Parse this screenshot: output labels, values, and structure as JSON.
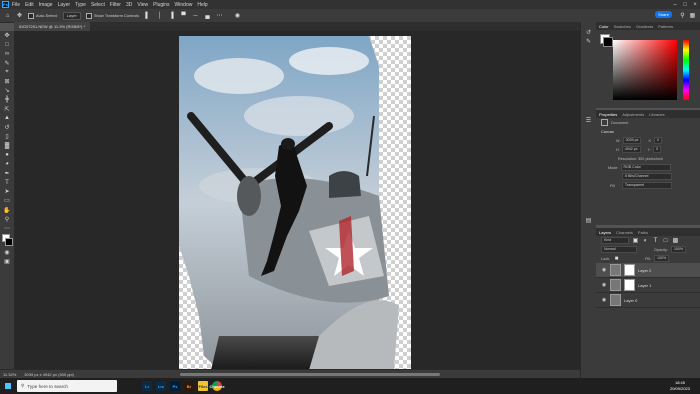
{
  "app": {
    "logo": "Ps",
    "menus": [
      "File",
      "Edit",
      "Image",
      "Layer",
      "Type",
      "Select",
      "Filter",
      "3D",
      "View",
      "Plugins",
      "Window",
      "Help"
    ],
    "window_controls": [
      "minimize-icon",
      "maximize-icon",
      "close-icon"
    ]
  },
  "options_bar": {
    "auto_select_label": "Auto-Select:",
    "auto_select_value": "Layer",
    "transform_label": "Show Transform Controls",
    "share_label": "Share"
  },
  "document": {
    "tab_title": "IDG07251.NEW @ 11.3% (RGB/8*) *"
  },
  "status": {
    "zoom": "11.32%",
    "doc_size": "3039 px x 4942 px (300 ppi)"
  },
  "color_panel": {
    "tabs": [
      "Color",
      "Swatches",
      "Gradients",
      "Patterns"
    ],
    "accent": "#ff0000"
  },
  "properties_panel": {
    "tabs": [
      "Properties",
      "Adjustments",
      "Libraries"
    ],
    "doc_label": "Document",
    "canvas_heading": "Canvas",
    "w_label": "W",
    "w_value": "3039 px",
    "h_label": "H",
    "h_value": "4942 px",
    "x_label": "X",
    "x_value": "0",
    "y_label": "Y",
    "y_value": "0",
    "resolution": "Resolution: 300 pixels/inch",
    "mode_label": "Mode",
    "mode_value": "RGB Color",
    "depth_value": "8 Bits/Channel",
    "fill_label": "Fill",
    "fill_value": "Transparent"
  },
  "layers_panel": {
    "tabs": [
      "Layers",
      "Channels",
      "Paths"
    ],
    "kind_label": "Kind",
    "blend_mode": "Normal",
    "opacity_label": "Opacity:",
    "opacity_value": "100%",
    "lock_label": "Lock:",
    "fill_label": "Fill:",
    "fill_value": "100%",
    "layers": [
      {
        "name": "Layer 2",
        "visible": true,
        "selected": true
      },
      {
        "name": "Layer 1",
        "visible": true,
        "selected": false
      },
      {
        "name": "Layer 0",
        "visible": true,
        "selected": false
      }
    ]
  },
  "taskbar": {
    "search_placeholder": "Type here to search",
    "apps": [
      "Lr",
      "Lrc",
      "Ps",
      "Br",
      "Files",
      "Chrome"
    ],
    "time": "18:45",
    "date": "20/09/2023"
  }
}
